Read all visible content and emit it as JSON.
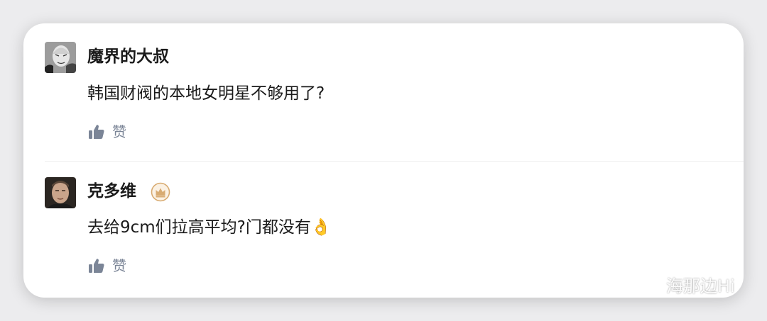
{
  "comments": [
    {
      "user": "魔界的大叔",
      "avatar_icon": "bald-man-sketch-avatar",
      "text": "韩国财阀的本地女明星不够用了?",
      "like_label": "赞",
      "like_icon": "thumbs-up-icon"
    },
    {
      "user": "克多维",
      "avatar_icon": "man-face-photo-avatar",
      "badge_icon": "crown-badge-icon",
      "text": "去给9cm们拉高平均?门都没有👌",
      "like_label": "赞",
      "like_icon": "thumbs-up-icon"
    }
  ],
  "watermark": {
    "icon": "wechat-icon",
    "text": "海那边Hi"
  },
  "colors": {
    "like_icon": "#7b8597",
    "badge": "#d8ab72",
    "text": "#1b1b1b",
    "divider": "#efefef"
  }
}
